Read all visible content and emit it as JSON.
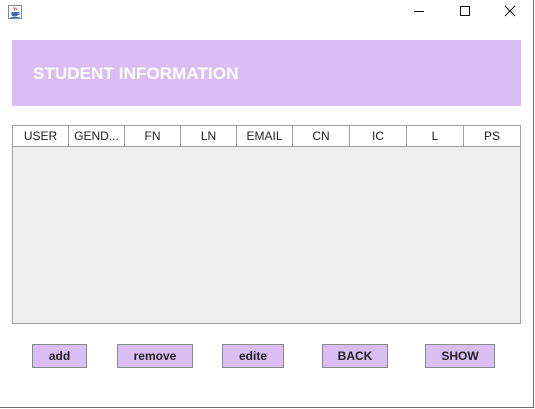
{
  "header": {
    "title": "STUDENT INFORMATION"
  },
  "table": {
    "columns": [
      "USER",
      "GEND...",
      "FN",
      "LN",
      "EMAIL",
      "CN",
      "IC",
      "L",
      "PS"
    ],
    "rows": []
  },
  "buttons": {
    "add": "add",
    "remove": "remove",
    "edite": "edite",
    "back": "BACK",
    "show": "SHOW"
  },
  "colors": {
    "accent": "#dabdf3",
    "header_text": "#ffffff",
    "table_body": "#eeeeee"
  },
  "icons": {
    "app": "java-cup-icon",
    "minimize": "minimize-icon",
    "maximize": "maximize-icon",
    "close": "close-icon"
  }
}
